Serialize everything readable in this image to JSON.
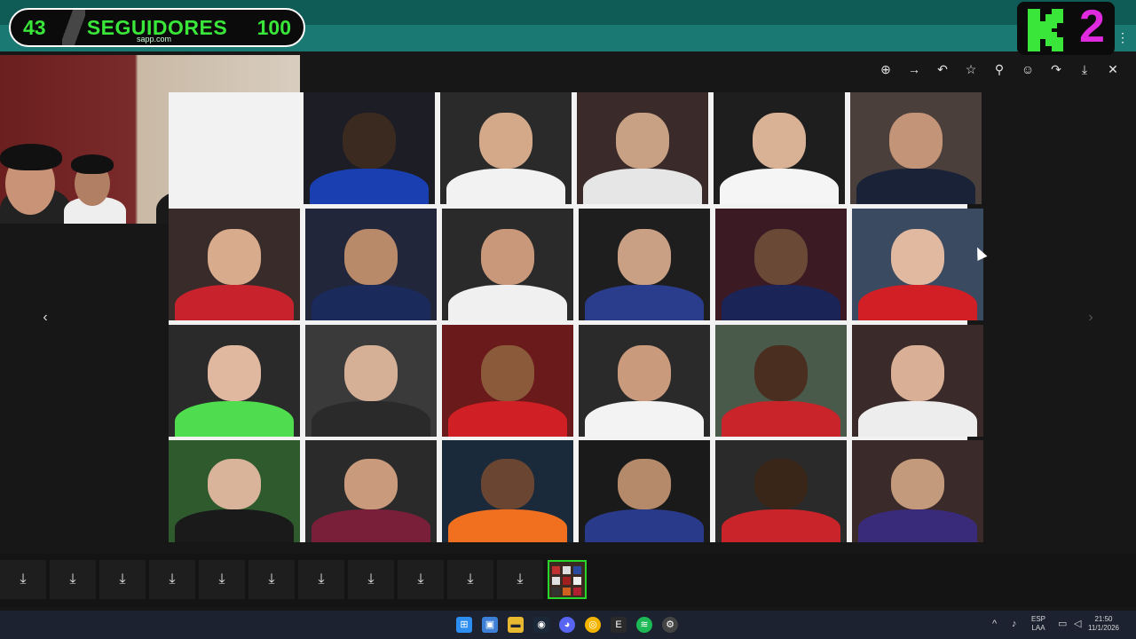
{
  "overlay": {
    "counter_left": "43",
    "counter_title": "SEGUIDORES",
    "counter_right": "100",
    "url_fragment": "sapp.com",
    "kick_number": "2"
  },
  "viewer": {
    "toolbar": [
      {
        "name": "zoom-in-icon",
        "glyph": "⊕"
      },
      {
        "name": "arrow-right-icon",
        "glyph": "→"
      },
      {
        "name": "undo-icon",
        "glyph": "↶"
      },
      {
        "name": "star-icon",
        "glyph": "☆"
      },
      {
        "name": "pin-icon",
        "glyph": "⚲"
      },
      {
        "name": "emoji-icon",
        "glyph": "☺"
      },
      {
        "name": "share-icon",
        "glyph": "↷"
      },
      {
        "name": "download-icon",
        "glyph": "⤓"
      },
      {
        "name": "close-icon",
        "glyph": "✕"
      }
    ],
    "prev_glyph": "‹",
    "next_glyph": "›"
  },
  "collage": {
    "rows": [
      [
        {
          "face": "#3a2a20",
          "jersey": "#1a3fb0",
          "bg": "#1d1d26"
        },
        {
          "face": "#d4a98a",
          "jersey": "#f2f2f2",
          "bg": "#2a2a2a"
        },
        {
          "face": "#c8a185",
          "jersey": "#e6e6e6",
          "bg": "#3b2a2a"
        },
        {
          "face": "#d9b295",
          "jersey": "#f5f5f5",
          "bg": "#1e1e1e"
        },
        {
          "face": "#c49478",
          "jersey": "#1a2238",
          "bg": "#4a3f3a"
        }
      ],
      [
        {
          "face": "#d7ab8c",
          "jersey": "#c8232c",
          "bg": "#3a2b2b"
        },
        {
          "face": "#b88a6a",
          "jersey": "#1a2a5a",
          "bg": "#22263a"
        },
        {
          "face": "#c9987a",
          "jersey": "#f0f0f0",
          "bg": "#2a2a2a"
        },
        {
          "face": "#caa084",
          "jersey": "#2a3c8c",
          "bg": "#1e1e1e"
        },
        {
          "face": "#6a4a36",
          "jersey": "#1b2456",
          "bg": "#3b1a24"
        },
        {
          "face": "#e0b9a0",
          "jersey": "#d21f26",
          "bg": "#3a4a60"
        }
      ],
      [
        {
          "face": "#e0b8a0",
          "jersey": "#4fdc4f",
          "bg": "#2a2a2a"
        },
        {
          "face": "#d6b096",
          "jersey": "#2a2a2a",
          "bg": "#3a3a3a"
        },
        {
          "face": "#8a5a3a",
          "jersey": "#d01f25",
          "bg": "#6a1a1a"
        },
        {
          "face": "#c99a7c",
          "jersey": "#f3f3f3",
          "bg": "#2a2a2a"
        },
        {
          "face": "#4a2e20",
          "jersey": "#c8242a",
          "bg": "#4a5a4a"
        },
        {
          "face": "#d9b096",
          "jersey": "#ededed",
          "bg": "#3a2a2a"
        }
      ],
      [
        {
          "face": "#d9b49a",
          "jersey": "#1a1a1a",
          "bg": "#2e5a2e"
        },
        {
          "face": "#c99a7c",
          "jersey": "#7a1f3a",
          "bg": "#2a2a2a"
        },
        {
          "face": "#6a4632",
          "jersey": "#f07020",
          "bg": "#1a2a3a"
        },
        {
          "face": "#b48a6a",
          "jersey": "#2a3a8a",
          "bg": "#1a1a1a"
        },
        {
          "face": "#3a2618",
          "jersey": "#c8242a",
          "bg": "#2a2a2a"
        },
        {
          "face": "#c49a7c",
          "jersey": "#3a2a7a",
          "bg": "#3a2a2a"
        }
      ]
    ]
  },
  "strip": {
    "download_glyph": "⤓",
    "download_count": 11
  },
  "taskbar": {
    "lang_top": "ESP",
    "lang_bottom": "LAA",
    "time": "21:50",
    "date": "11/1/2026"
  },
  "colors": {
    "accent_green": "#39e639",
    "kick_pink": "#e02adf",
    "browser_teal": "#1a7a73"
  }
}
